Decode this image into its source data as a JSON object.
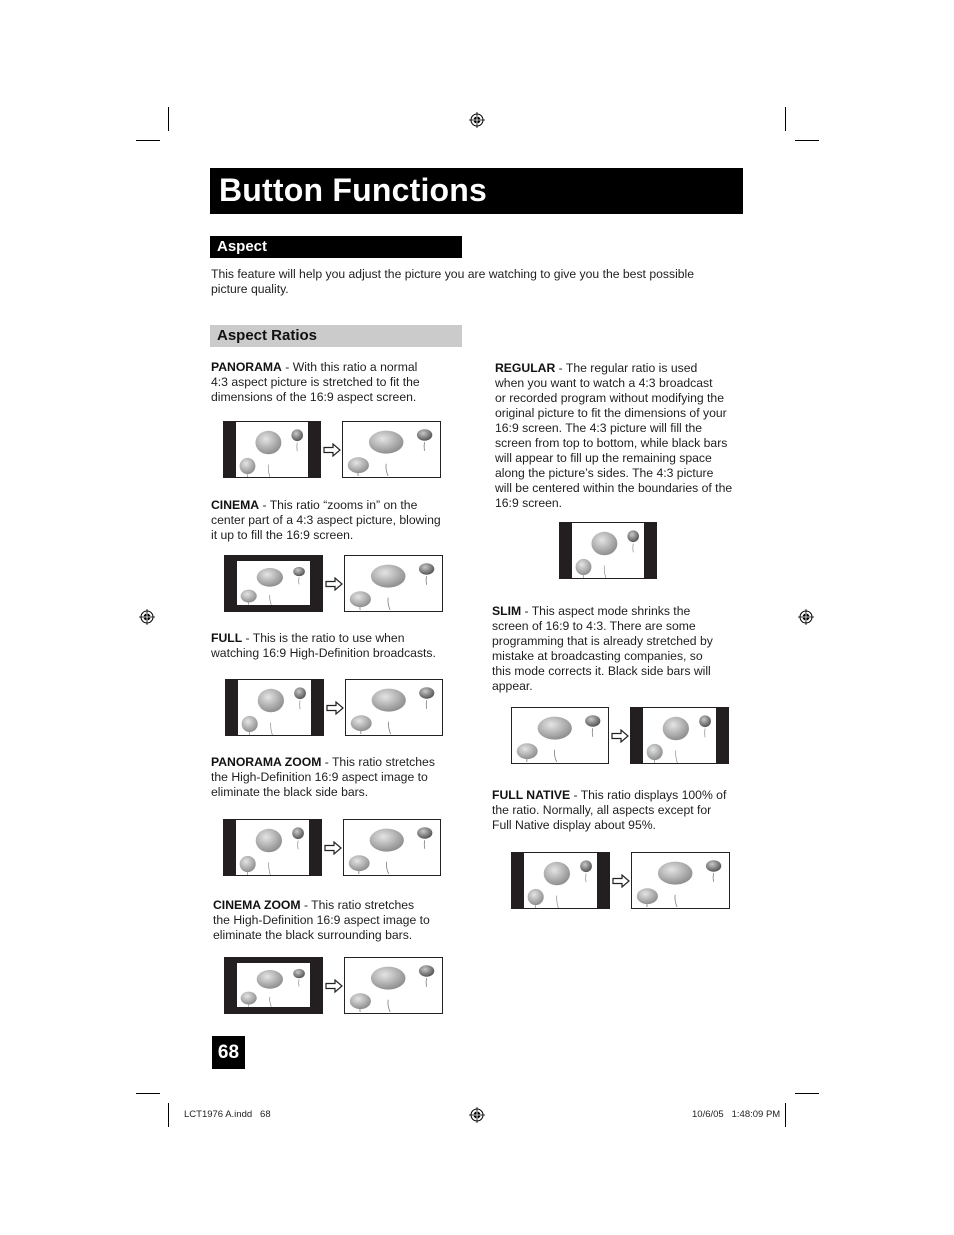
{
  "header": {
    "title": "Button Functions"
  },
  "sections": {
    "aspect": {
      "heading": "Aspect",
      "intro_line1": "This feature will help you adjust the picture you are watching to give you the best possible",
      "intro_line2": "picture quality."
    },
    "aspect_ratios": {
      "heading": "Aspect Ratios"
    }
  },
  "modes": {
    "panorama": {
      "name": "PANORAMA",
      "lines": [
        " - With this ratio a normal",
        "4:3 aspect picture is stretched to fit the",
        "dimensions of the 16:9 aspect screen."
      ]
    },
    "cinema": {
      "name": "CINEMA",
      "lines": [
        " - This ratio “zooms in” on the",
        "center part of a 4:3 aspect picture, blowing",
        "it up to fill the 16:9 screen."
      ]
    },
    "full": {
      "name": "FULL",
      "lines": [
        " - This is the ratio to use when",
        "watching 16:9 High-Definition broadcasts."
      ]
    },
    "panorama_zoom": {
      "name": "PANORAMA ZOOM",
      "lines": [
        " - This ratio stretches",
        "the High-Definition 16:9 aspect image to",
        "eliminate the black side bars."
      ]
    },
    "cinema_zoom": {
      "name": "CINEMA ZOOM",
      "lines": [
        " - This ratio stretches",
        "the High-Definition 16:9 aspect image to",
        "eliminate the black surrounding bars."
      ]
    },
    "regular": {
      "name": "REGULAR",
      "lines": [
        " - The regular ratio is used",
        "when you want to watch a 4:3 broadcast",
        "or recorded program without modifying the",
        "original picture to fit the dimensions of your",
        "16:9 screen. The 4:3 picture will fill the",
        "screen from top to bottom, while black bars",
        "will appear to fill up the remaining space",
        "along the picture’s sides. The 4:3 picture",
        "will be centered within the boundaries of the",
        "16:9 screen."
      ]
    },
    "slim": {
      "name": "SLIM",
      "lines": [
        " - This aspect mode shrinks the",
        "screen of 16:9 to 4:3.  There are some",
        "programming that is already stretched by",
        "mistake at broadcasting companies, so",
        "this mode corrects it.  Black side bars will",
        "appear."
      ]
    },
    "full_native": {
      "name": "FULL NATIVE",
      "lines": [
        " - This ratio displays 100% of",
        "the ratio.  Normally, all aspects except for",
        "Full Native display about 95%."
      ]
    }
  },
  "icons": {
    "arrow": "right-arrow-icon",
    "registration": "registration-mark-icon",
    "balloon": "balloon-illustration"
  },
  "footer": {
    "page_number": "68",
    "slug_left": "LCT1976 A.indd   68",
    "slug_right": "10/6/05   1:48:09 PM"
  },
  "colors": {
    "title_bar": "#000000",
    "section_gray": "#cbcbcb",
    "bar_dark": "#231f20"
  }
}
